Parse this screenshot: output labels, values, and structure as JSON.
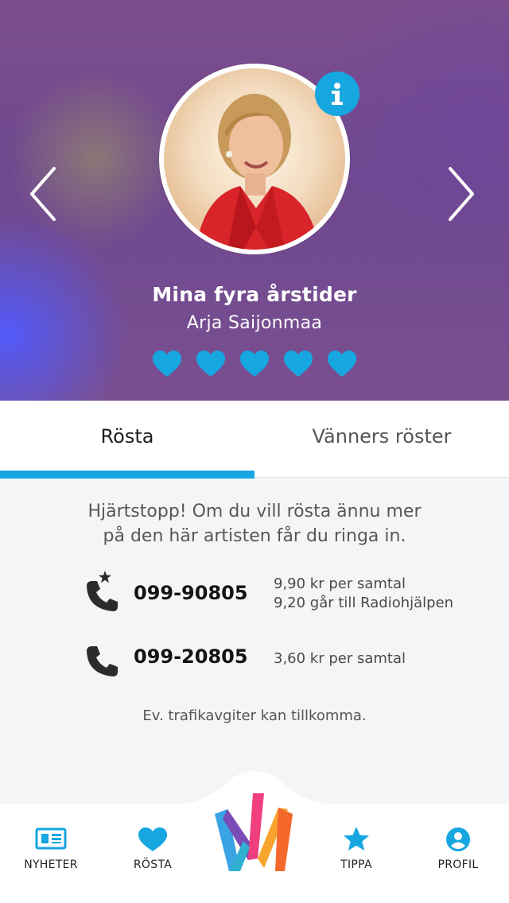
{
  "artist_card": {
    "song_title": "Mina fyra årstider",
    "artist_name": "Arja Saijonmaa",
    "photo_icon": "artist-photo",
    "info_icon": "info-icon",
    "hearts_count": 5,
    "heart_color": "#16a6e0"
  },
  "tabs": [
    {
      "label": "Rösta",
      "active": true
    },
    {
      "label": "Vänners röster",
      "active": false
    }
  ],
  "vote": {
    "message_line1": "Hjärtstopp! Om du vill rösta ännu mer",
    "message_line2": "på den här artisten får du ringa in.",
    "phones": [
      {
        "number": "099-90805",
        "price_line1": "9,90 kr per samtal",
        "price_line2": "9,20 går till Radiohjälpen"
      },
      {
        "number": "099-20805",
        "price_line1": "3,60 kr per samtal"
      }
    ],
    "disclaimer": "Ev. trafikavgiter kan tillkomma."
  },
  "bottom_nav": {
    "items": [
      {
        "label": "NYHETER",
        "icon": "news-icon"
      },
      {
        "label": "RÖSTA",
        "icon": "heart-icon"
      },
      {
        "label": "TIPPA",
        "icon": "star-icon"
      },
      {
        "label": "PROFIL",
        "icon": "profile-icon"
      }
    ],
    "logo": "melodifestivalen-logo"
  },
  "colors": {
    "accent": "#16a6e0",
    "hero_purple": "#6e4890"
  }
}
